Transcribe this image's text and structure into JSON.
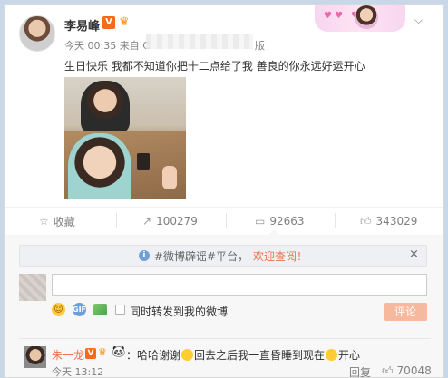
{
  "post": {
    "username": "李易峰",
    "verified_mark": "V",
    "timestamp": "今天 00:35 来自 C",
    "source_suffix": "版",
    "text": "生日快乐 我都不知道你把十二点给了我 善良的你永远好运开心",
    "menu_icon": "chevron-down-icon"
  },
  "actions": {
    "favorite": {
      "icon": "bookmark-icon",
      "label": "收藏"
    },
    "repost": {
      "icon": "repost-icon",
      "count": "100279"
    },
    "comment": {
      "icon": "comment-icon",
      "count": "92663"
    },
    "like": {
      "icon": "thumbs-up-icon",
      "count": "343029"
    }
  },
  "notice": {
    "info_icon": "i",
    "text": "#微博辟谣#平台，",
    "link": "欢迎查阅！",
    "close": "×"
  },
  "composer": {
    "input_value": "",
    "emoji_icon": "☺",
    "gif_label": "GIF",
    "repost_option": "同时转发到我的微博",
    "submit_label": "评论"
  },
  "comment": {
    "name": "朱一龙",
    "verified_mark": "V",
    "text_before": "：哈哈谢谢",
    "text_middle": "回去之后我一直昏睡到现在",
    "text_after": "开心",
    "time": "今天 13:12",
    "reply_label": "回复",
    "like_count": "70048"
  },
  "colors": {
    "accent": "#eb7350",
    "verified": "#f56b1b",
    "page_bg": "#c8d8e8"
  }
}
